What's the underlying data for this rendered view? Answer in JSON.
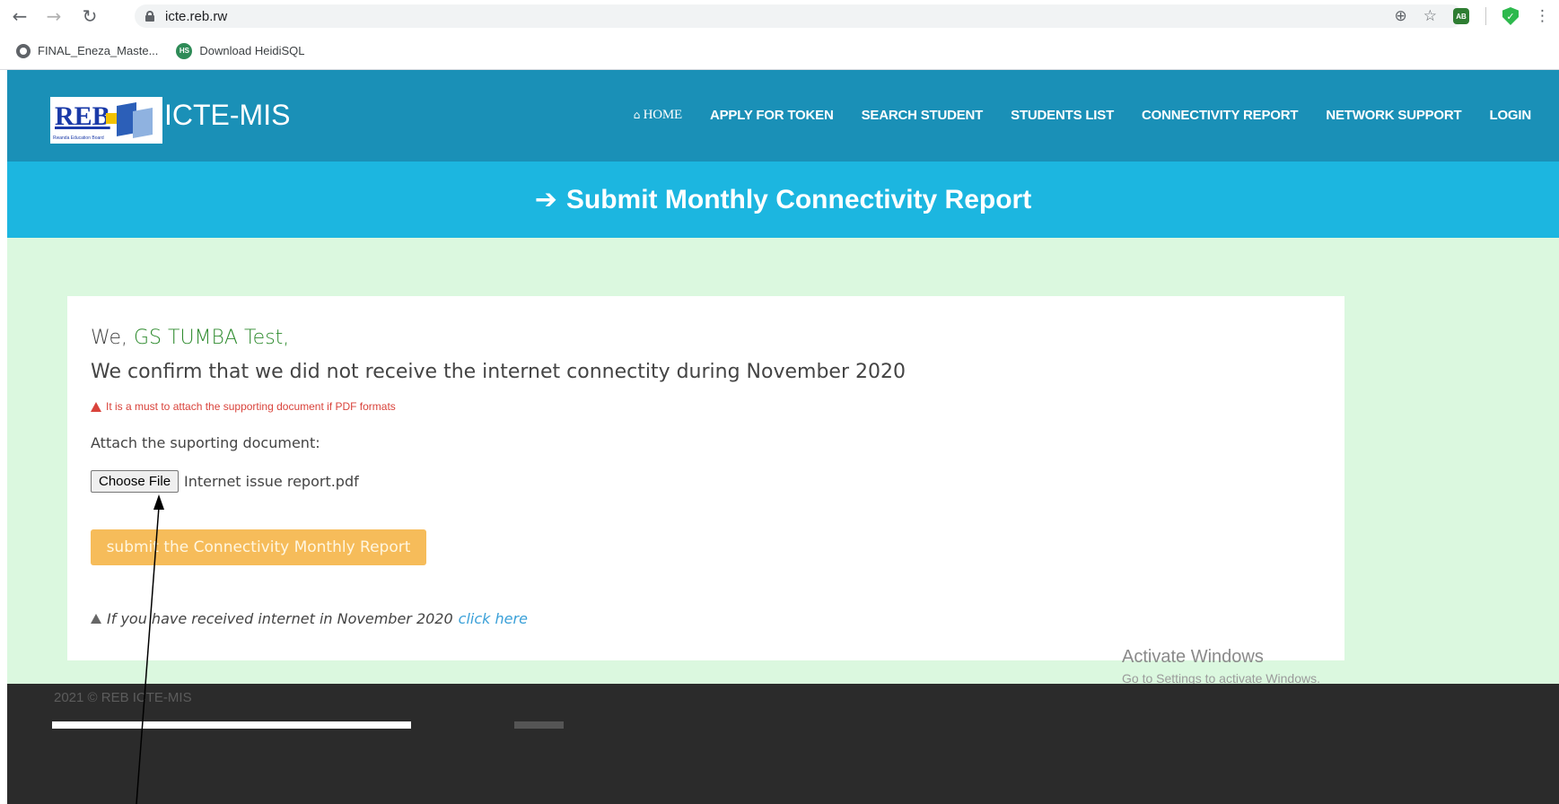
{
  "browser": {
    "url": "icte.reb.rw",
    "bookmarks": [
      {
        "label": "FINAL_Eneza_Maste..."
      },
      {
        "label": "Download HeidiSQL",
        "icon_text": "HS"
      }
    ],
    "ext_ab_label": "AB"
  },
  "header": {
    "logo_text": "REB",
    "logo_subtext": "Rwanda Education Board",
    "site_title": "ICTE-MIS",
    "nav": {
      "home": "HOME",
      "apply_token": "APPLY FOR TOKEN",
      "search_student": "SEARCH STUDENT",
      "students_list": "STUDENTS LIST",
      "connectivity_report": "CONNECTIVITY REPORT",
      "network_support": "NETWORK SUPPORT",
      "login": "LOGIN"
    }
  },
  "page_title": "Submit Monthly Connectivity Report",
  "form": {
    "we_prefix": "We,",
    "school_name": "GS TUMBA Test,",
    "confirm_text": "We confirm that we did not receive the internet connectity during November 2020",
    "warning": "It is a must to attach the supporting document if PDF formats",
    "attach_label": "Attach the suporting document:",
    "choose_file_label": "Choose File",
    "file_name": "Internet issue report.pdf",
    "submit_label": "submit the Connectivity Monthly Report",
    "received_text": "If you have received internet in November 2020",
    "click_here": "click here"
  },
  "watermark": {
    "line1": "Activate Windows",
    "line2": "Go to Settings to activate Windows."
  },
  "footer": {
    "copyright": "2021 © REB ICTE-MIS"
  },
  "colors": {
    "header_bg": "#1a90b7",
    "title_band_bg": "#1cb6e0",
    "main_bg": "#dbf8df",
    "submit_bg": "#f6bc5a",
    "school_name": "#2e8b2e",
    "warning": "#d9433b",
    "link": "#3aa0d8",
    "footer_bg": "#2b2b2b"
  },
  "icons": {
    "back": "back-arrow-icon",
    "forward": "forward-arrow-icon",
    "reload": "reload-icon",
    "lock": "lock-icon",
    "zoom": "zoom-icon",
    "star": "star-icon",
    "home": "home-icon",
    "arrow": "arrow-right-icon",
    "warning": "warning-icon"
  }
}
